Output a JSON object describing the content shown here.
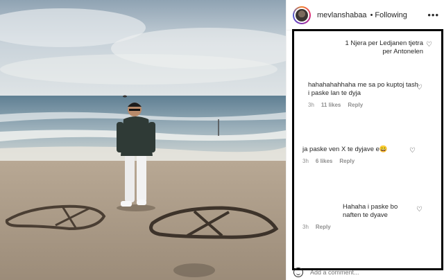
{
  "post": {
    "username": "mevlanshabaa",
    "separator": "•",
    "follow_label": "Following"
  },
  "comments": [
    {
      "user": "",
      "text": "1 Njera per Ledjanen tjetra per Antonelen",
      "time": "",
      "likes": "",
      "reply": ""
    },
    {
      "user": "",
      "text": "hahahahahhaha me sa po kuptoj tash i paske lan te dyja",
      "time": "3h",
      "likes": "11 likes",
      "reply": "Reply"
    },
    {
      "user": "",
      "text": "ja paske ven X te dyjave e😄",
      "time": "3h",
      "likes": "6 likes",
      "reply": "Reply"
    },
    {
      "user": "",
      "text": "Hahaha i paske bo naften te dyave",
      "time": "3h",
      "likes": "",
      "reply": "Reply"
    }
  ],
  "add_comment": {
    "placeholder": "Add a comment..."
  },
  "icons": {
    "heart": "heart-icon",
    "emoji": "smile-icon",
    "more": "more-icon"
  }
}
